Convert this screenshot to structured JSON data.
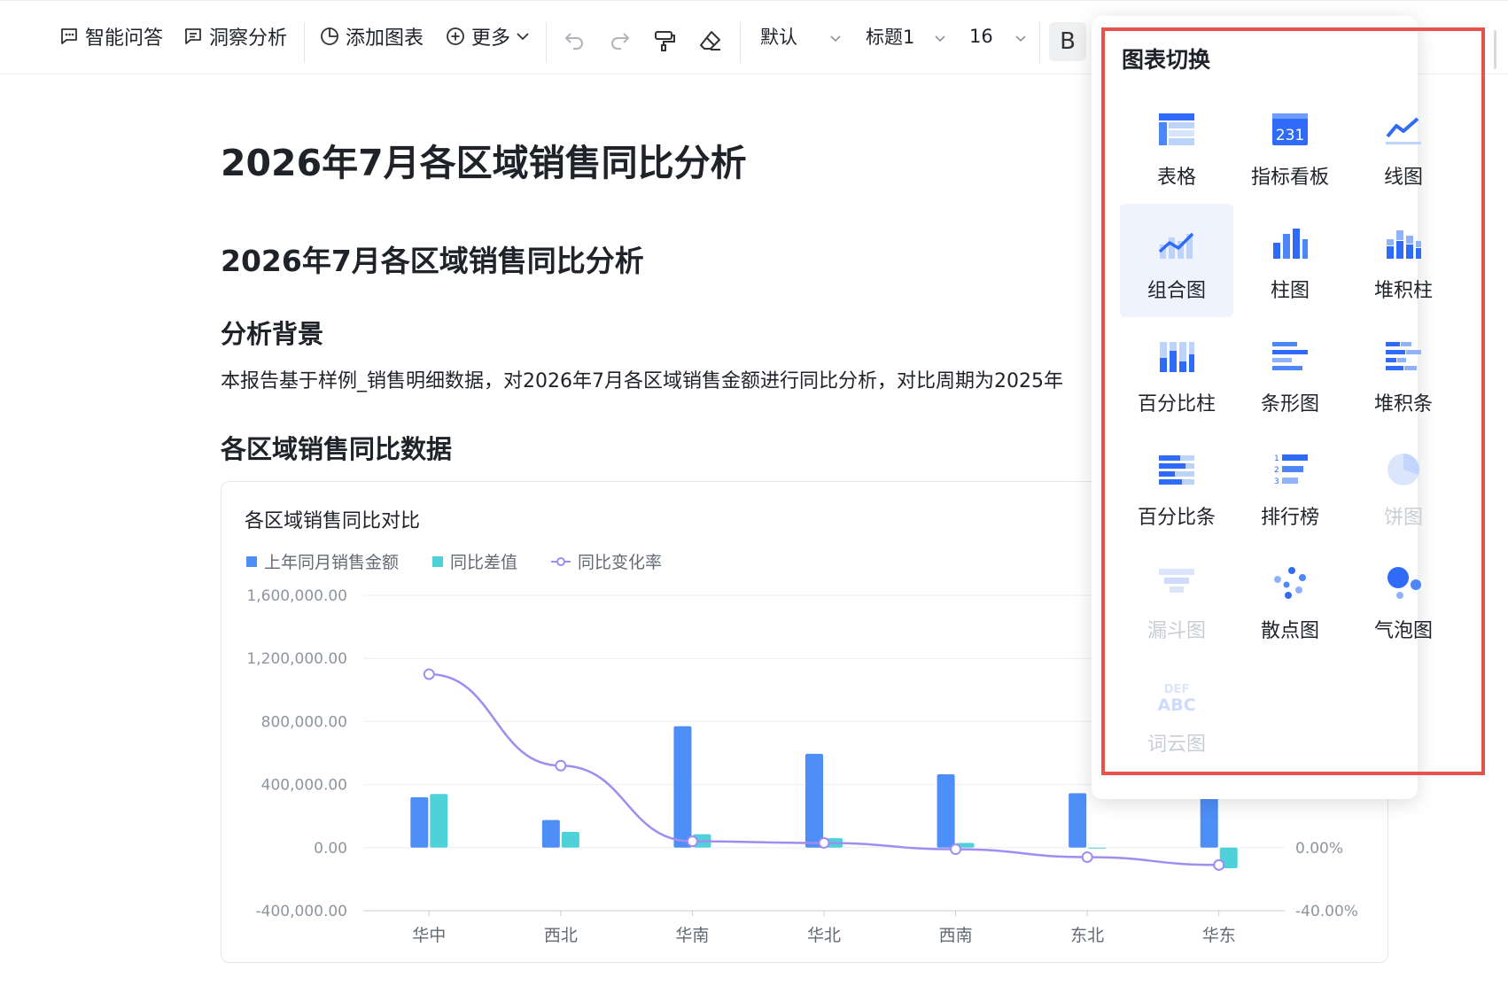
{
  "toolbar": {
    "ask_label": "智能问答",
    "insight_label": "洞察分析",
    "add_chart_label": "添加图表",
    "more_label": "更多",
    "font_family": "默认",
    "heading_style": "标题1",
    "font_size": "16",
    "bold_label": "B"
  },
  "document": {
    "title": "2026年7月各区域销售同比分析",
    "heading": "2026年7月各区域销售同比分析",
    "section_background": "分析背景",
    "paragraph": "本报告基于样例_销售明细数据，对2026年7月各区域销售金额进行同比分析，对比周期为2025年",
    "section_data": "各区域销售同比数据"
  },
  "chart_data": {
    "type": "bar",
    "title": "各区域销售同比对比",
    "categories": [
      "华中",
      "西北",
      "华南",
      "华北",
      "西南",
      "东北",
      "华东"
    ],
    "series": [
      {
        "name": "上年同月销售金额",
        "type": "bar",
        "axis": "left",
        "color": "#4e8ef7",
        "values": [
          320000,
          175000,
          770000,
          595000,
          465000,
          345000,
          370000
        ]
      },
      {
        "name": "同比差值",
        "type": "bar",
        "axis": "left",
        "color": "#4fd1d9",
        "values": [
          340000,
          100000,
          85000,
          60000,
          30000,
          -5000,
          -130000
        ]
      },
      {
        "name": "同比变化率",
        "type": "line",
        "axis": "right",
        "color": "#a18cf2",
        "values": [
          1.1,
          0.52,
          0.04,
          0.03,
          -0.01,
          -0.06,
          -0.11
        ]
      }
    ],
    "left_axis": {
      "ticks": [
        "1,600,000.00",
        "1,200,000.00",
        "800,000.00",
        "400,000.00",
        "0.00",
        "-400,000.00"
      ],
      "range": [
        -400000,
        1600000
      ]
    },
    "right_axis": {
      "ticks": [
        "0.00%",
        "-40.00%"
      ],
      "range": [
        -0.4,
        1.6
      ]
    },
    "grid": true,
    "legend_position": "top-left"
  },
  "chart_switch_panel": {
    "title": "图表切换",
    "options": [
      {
        "label": "表格",
        "icon": "table-icon",
        "enabled": true,
        "selected": false
      },
      {
        "label": "指标看板",
        "icon": "kpi-board-icon",
        "icon_text": "231",
        "enabled": true,
        "selected": false
      },
      {
        "label": "线图",
        "icon": "line-chart-icon",
        "enabled": true,
        "selected": false
      },
      {
        "label": "组合图",
        "icon": "combo-chart-icon",
        "enabled": true,
        "selected": true
      },
      {
        "label": "柱图",
        "icon": "bar-chart-icon",
        "enabled": true,
        "selected": false
      },
      {
        "label": "堆积柱",
        "icon": "stacked-bar-icon",
        "enabled": true,
        "selected": false
      },
      {
        "label": "百分比柱",
        "icon": "percent-column-icon",
        "enabled": true,
        "selected": false
      },
      {
        "label": "条形图",
        "icon": "horizontal-bar-icon",
        "enabled": true,
        "selected": false
      },
      {
        "label": "堆积条",
        "icon": "stacked-horizontal-bar-icon",
        "enabled": true,
        "selected": false
      },
      {
        "label": "百分比条",
        "icon": "percent-bar-icon",
        "enabled": true,
        "selected": false
      },
      {
        "label": "排行榜",
        "icon": "ranking-icon",
        "icon_text": "123",
        "enabled": true,
        "selected": false
      },
      {
        "label": "饼图",
        "icon": "pie-chart-icon",
        "enabled": false,
        "selected": false
      },
      {
        "label": "漏斗图",
        "icon": "funnel-chart-icon",
        "enabled": false,
        "selected": false
      },
      {
        "label": "散点图",
        "icon": "scatter-chart-icon",
        "enabled": true,
        "selected": false
      },
      {
        "label": "气泡图",
        "icon": "bubble-chart-icon",
        "enabled": true,
        "selected": false
      },
      {
        "label": "词云图",
        "icon": "word-cloud-icon",
        "icon_text": [
          "DEF",
          "ABC"
        ],
        "enabled": false,
        "selected": false
      }
    ]
  },
  "colors": {
    "accent": "#3370ff",
    "highlight_border": "#e5534b",
    "selected_bg": "#eef3fe"
  }
}
